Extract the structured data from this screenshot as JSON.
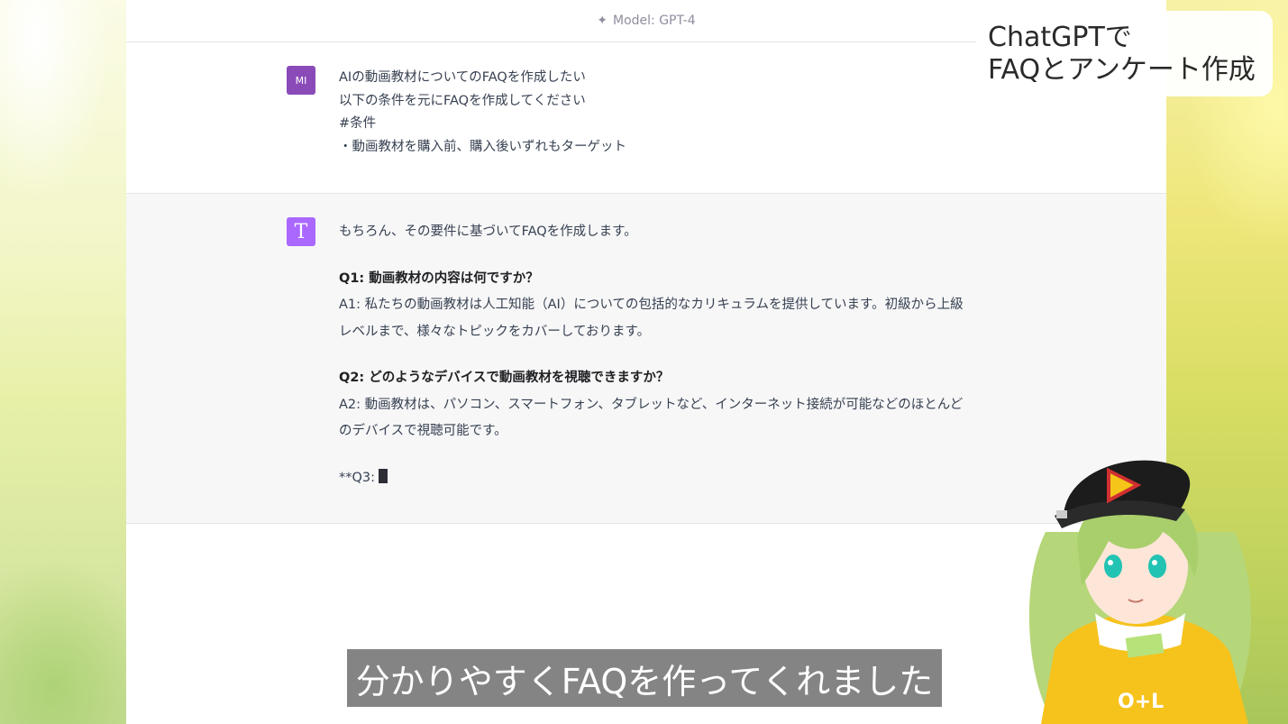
{
  "header": {
    "model_label": "Model: GPT-4",
    "sparkle_icon": "sparkle-icon"
  },
  "user_message": {
    "avatar_initials": "MI",
    "lines": [
      "AIの動画教材についてのFAQを作成したい",
      "以下の条件を元にFAQを作成してください",
      "#条件",
      "・動画教材を購入前、購入後いずれもターゲット"
    ]
  },
  "assistant_message": {
    "avatar_glyph": "T",
    "intro": "もちろん、その要件に基づいてFAQを作成します。",
    "faqs": [
      {
        "q": "Q1: 動画教材の内容は何ですか？",
        "a": "A1: 私たちの動画教材は人工知能（AI）についての包括的なカリキュラムを提供しています。初級から上級レベルまで、様々なトピックをカバーしております。"
      },
      {
        "q": "Q2: どのようなデバイスで動画教材を視聴できますか？",
        "a": "A2: 動画教材は、パソコン、スマートフォン、タブレットなど、インターネット接続が可能などのほとんどのデバイスで視聴可能です。"
      }
    ],
    "partial": "**Q3:"
  },
  "overlay": {
    "caption_line1": "ChatGPTで",
    "caption_line2": "FAQとアンケート作成",
    "subtitle": "分かりやすくFAQを作ってくれました",
    "cap_text": "O+L"
  },
  "colors": {
    "user_avatar": "#8a4bb8",
    "gpt_avatar": "#ab68ff",
    "assistant_bg": "#f7f7f8"
  }
}
